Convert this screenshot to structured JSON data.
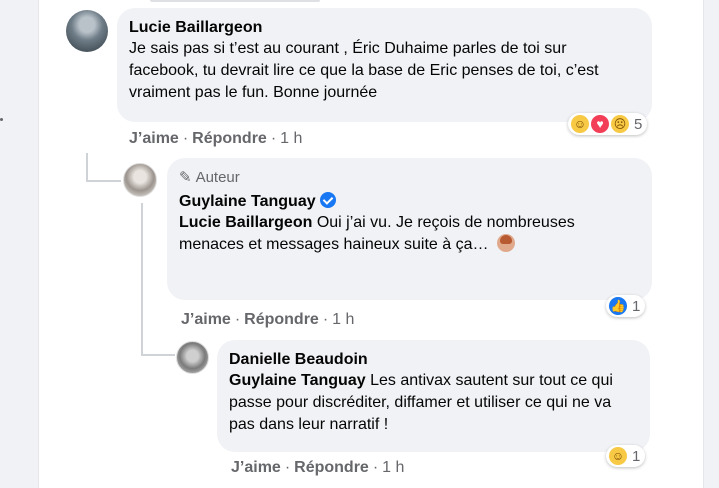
{
  "comments": {
    "lucie": {
      "name": "Lucie Baillargeon",
      "text": "Je sais pas si t’est au courant , Éric Duhaime parles de toi sur facebook, tu devrait lire ce que la base de Eric penses de toi, c’est vraiment pas le fun. Bonne journée",
      "like": "J’aime",
      "reply": "Répondre",
      "sep": "·",
      "time": "1 h",
      "reaction_count": "5",
      "reactions": [
        "haha",
        "love",
        "sad"
      ]
    },
    "guylaine": {
      "author_tag": "Auteur",
      "name": "Guylaine Tanguay",
      "mention": "Lucie Baillargeon",
      "text": "Oui j’ai vu. Je reçois de nombreuses menaces et messages haineux suite à ça…",
      "like": "J’aime",
      "reply": "Répondre",
      "sep": "·",
      "time": "1 h",
      "reaction_count": "1",
      "reactions": [
        "like"
      ]
    },
    "danielle": {
      "name": "Danielle Beaudoin",
      "mention": "Guylaine Tanguay",
      "text": "Les antivax sautent sur tout ce qui passe pour discréditer, diffamer et utiliser ce qui ne va pas dans leur narratif !",
      "like": "J’aime",
      "reply": "Répondre",
      "sep": "·",
      "time": "1 h",
      "reaction_count": "1",
      "reactions": [
        "haha"
      ]
    }
  },
  "icons": {
    "author": "pencil-icon",
    "verified": "verified-badge-icon",
    "haha": "haha-reaction-icon",
    "love": "love-reaction-icon",
    "sad": "sad-reaction-icon",
    "like": "like-reaction-icon"
  },
  "colors": {
    "meta_text": "#65676b",
    "bubble": "#f0f2f5",
    "verified": "#1877f2"
  }
}
